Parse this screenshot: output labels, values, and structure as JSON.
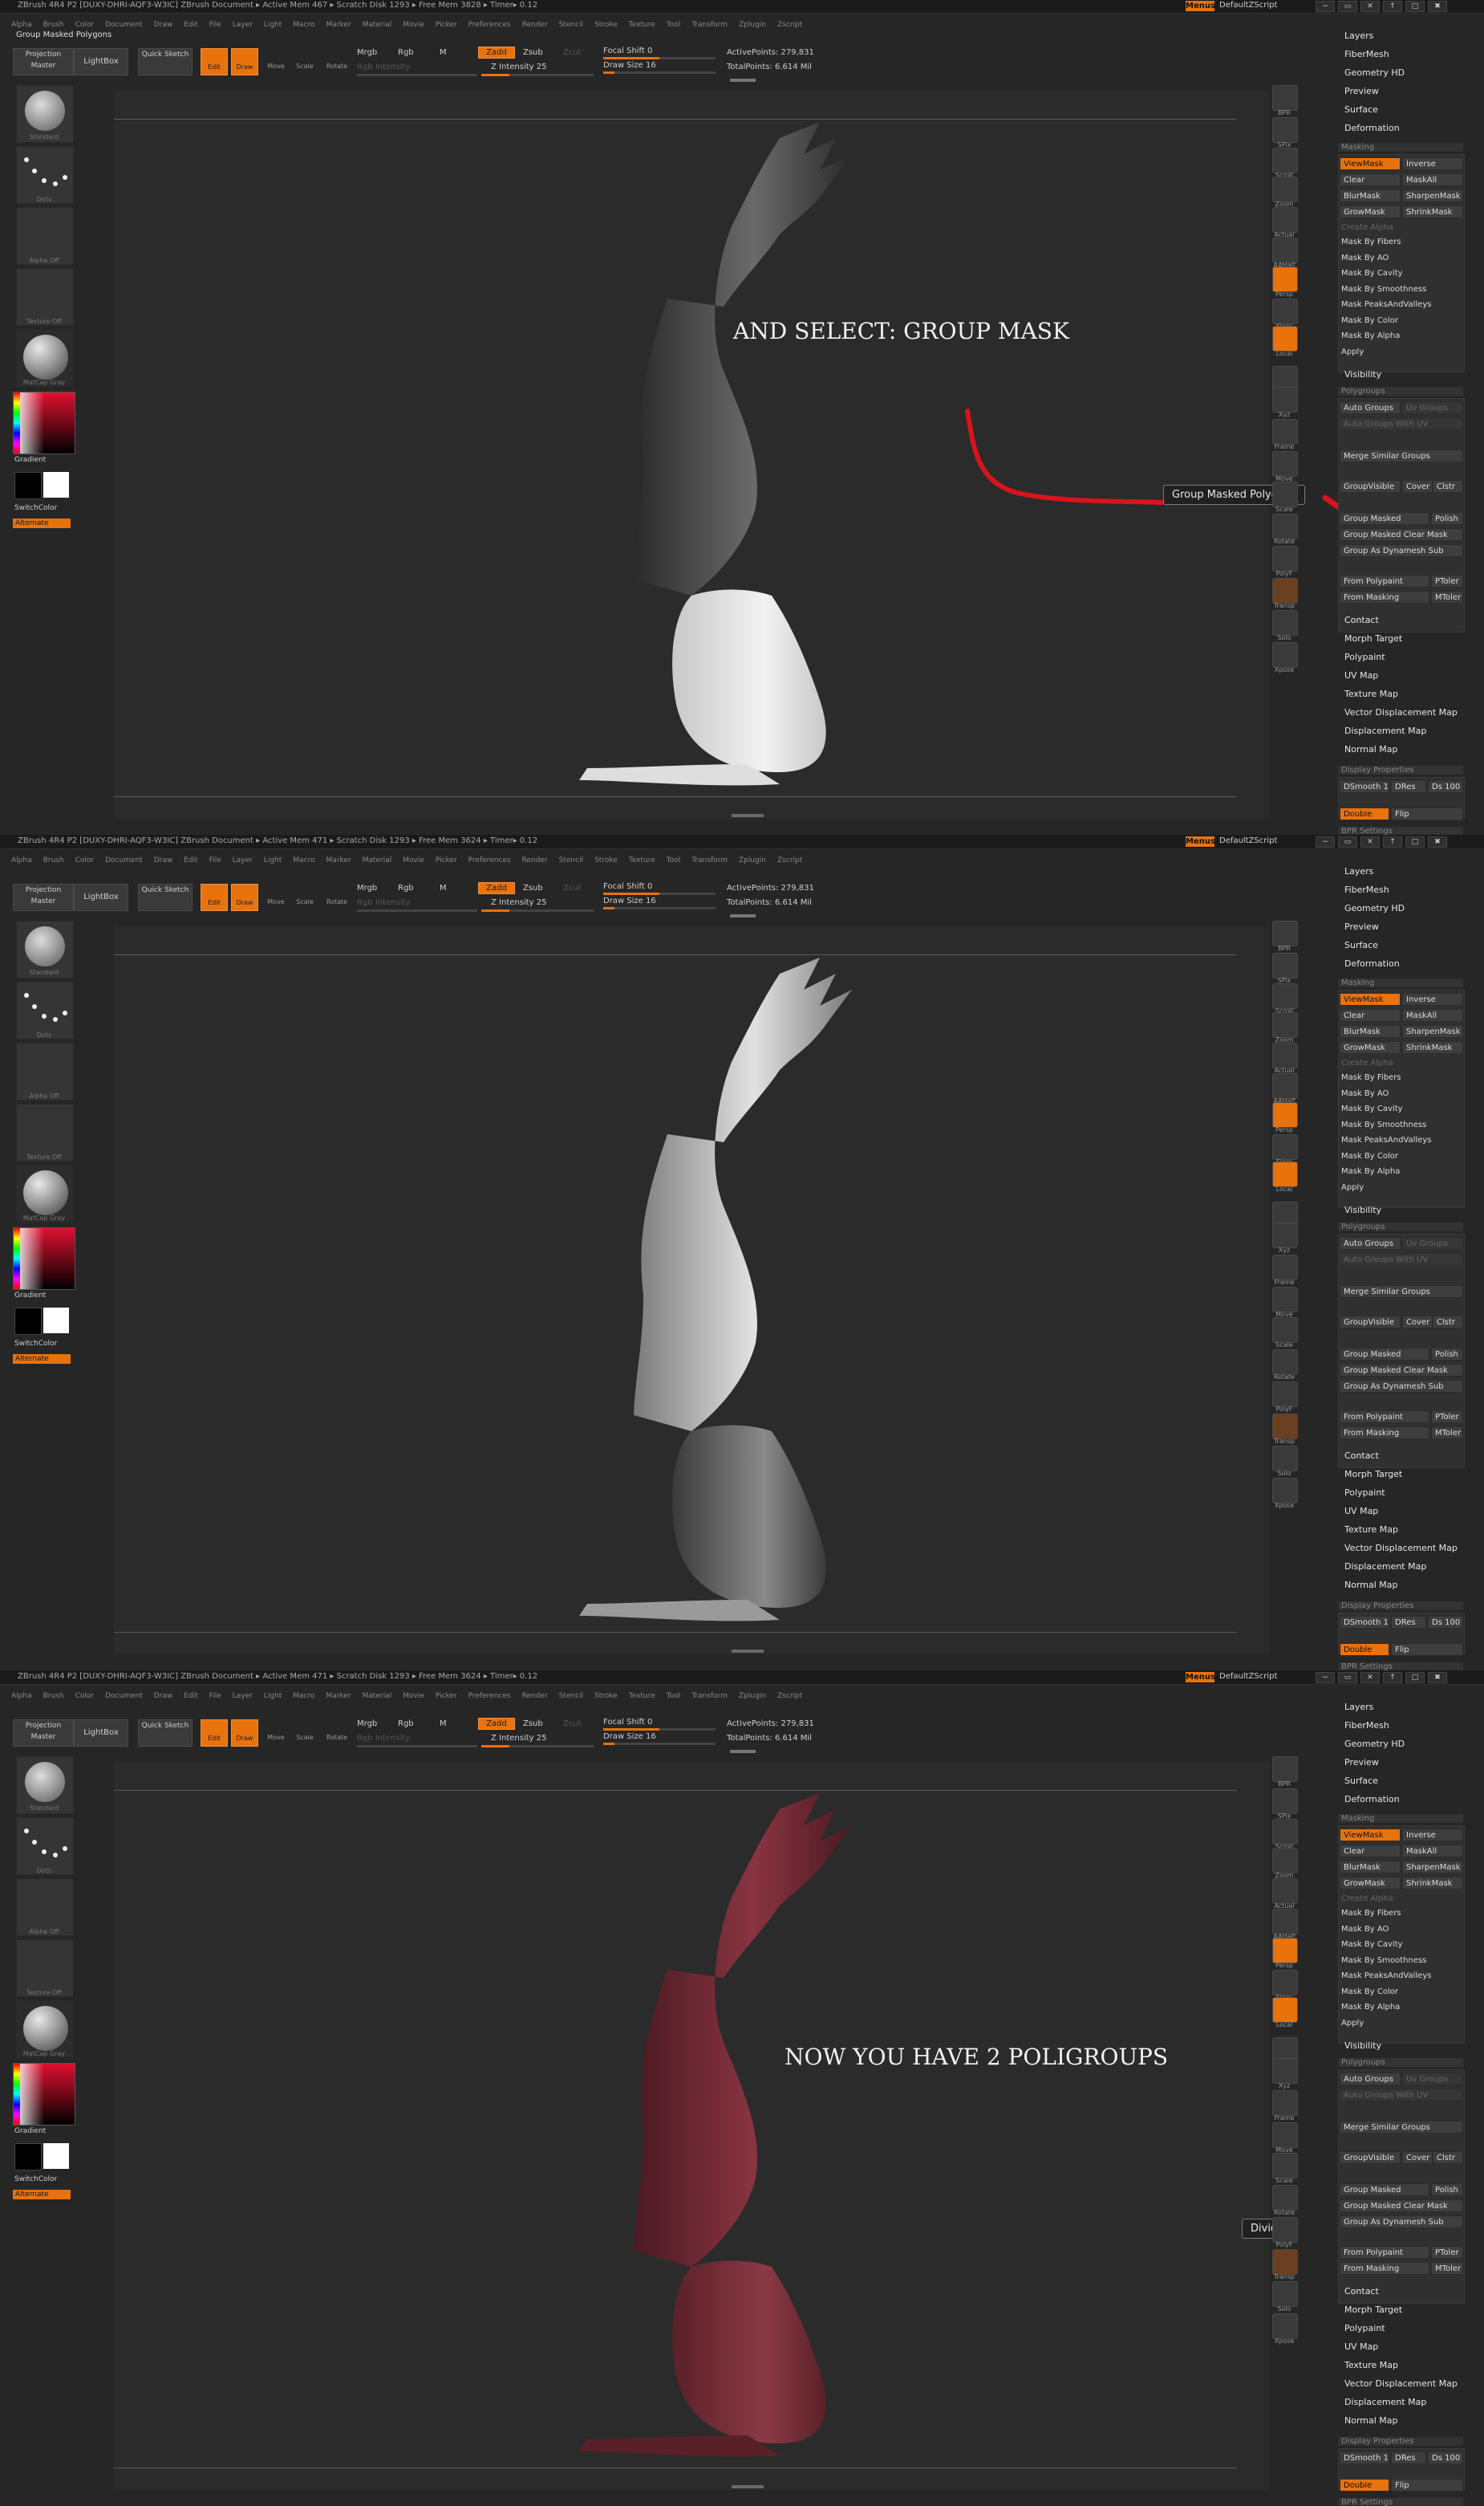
{
  "app": {
    "title_text": "ZBrush 4R4 P2 [DUXY-DHRI-AQF3-W3IC]    ZBrush Document",
    "status_text_p1": "▸ Active Mem 467 ▸ Scratch Disk 1293 ▸ Free Mem 3828 ▸ Timer▸ 0.12",
    "status_text_p2": "▸ Active Mem 471 ▸ Scratch Disk 1293 ▸ Free Mem 3624 ▸ Timer▸ 0.12",
    "status_text_p3": "▸ Active Mem 471 ▸ Scratch Disk 1293 ▸ Free Mem 3624 ▸ Timer▸ 0.12",
    "menus_label": "Menus",
    "default_script": "DefaultZScript",
    "tooltip_line_p1": "Group Masked Polygons",
    "window_buttons": [
      "−",
      "▭",
      "✕",
      "↑",
      "□",
      "✖"
    ]
  },
  "menubar": [
    "Alpha",
    "Brush",
    "Color",
    "Document",
    "Draw",
    "Edit",
    "File",
    "Layer",
    "Light",
    "Macro",
    "Marker",
    "Material",
    "Movie",
    "Picker",
    "Preferences",
    "Render",
    "Stencil",
    "Stroke",
    "Texture",
    "Tool",
    "Transform",
    "Zplugin",
    "Zscript"
  ],
  "toolbar": {
    "projection_master": "Projection Master",
    "lightbox": "LightBox",
    "quick_sketch": "Quick Sketch",
    "edit": "Edit",
    "draw": "Draw",
    "move": "Move",
    "scale": "Scale",
    "rotate": "Rotate",
    "mrgb": "Mrgb",
    "rgb": "Rgb",
    "m": "M",
    "rgb_intensity": "Rgb Intensity",
    "zadd": "Zadd",
    "zsub": "Zsub",
    "zcut": "Zcut",
    "z_intensity": "Z Intensity 25",
    "focal_shift": "Focal Shift 0",
    "draw_size": "Draw Size 16",
    "active_points": "ActivePoints: 279,831",
    "total_points": "TotalPoints: 6.614 Mil",
    "z_intensity_value": 25,
    "draw_size_value": 16
  },
  "left_shelf": {
    "standard": "Standard",
    "dots": "Dots",
    "alpha_off": "Alpha Off",
    "texture_off": "Texture Off",
    "matcap_gray": "MatCap Gray",
    "gradient": "Gradient",
    "switch_color": "SwitchColor",
    "alternate": "Alternate"
  },
  "right_icons": [
    "BPR",
    "SPix",
    "Scroll",
    "Zoom",
    "Actual",
    "AAHalf",
    "Persp",
    "Floor",
    "Local",
    "L.Sym",
    "Xyz",
    "Frame",
    "Move",
    "Scale",
    "Rotate",
    "PolyF",
    "Transp",
    "Solo",
    "Xpose"
  ],
  "right_palette": {
    "top_items": [
      "Layers",
      "FiberMesh",
      "Geometry HD",
      "Preview",
      "Surface",
      "Deformation"
    ],
    "masking_title": "Masking",
    "masking_buttons": [
      [
        "ViewMask",
        "Inverse"
      ],
      [
        "Clear",
        "MaskAll"
      ],
      [
        "BlurMask",
        "SharpenMask"
      ],
      [
        "GrowMask",
        "ShrinkMask"
      ]
    ],
    "create_alpha": "Create Alpha",
    "mask_items": [
      "Mask By Fibers",
      "Mask By AO",
      "Mask By Cavity",
      "Mask By Smoothness",
      "Mask PeaksAndValleys",
      "Mask By Color",
      "Mask By Alpha",
      "Apply"
    ],
    "visibility": "Visibility",
    "polygroups_title": "Polygroups",
    "auto_groups": "Auto Groups",
    "uv_groups": "Uv Groups",
    "auto_groups_uv": "Auto Groups With UV",
    "merge_similar": "Merge Similar Groups",
    "group_visible": "GroupVisible",
    "coverage": "Cover",
    "clstr": "Clstr",
    "group_masked": "Group Masked",
    "polish": "Polish",
    "group_masked_clear": "Group Masked Clear Mask",
    "group_as_dynamesh": "Group As Dynamesh Sub",
    "from_polypaint": "From Polypaint",
    "ptoler": "PToler",
    "from_masking": "From Masking",
    "mtoler": "MToler",
    "bottom_items": [
      "Contact",
      "Morph Target",
      "Polypaint",
      "UV Map",
      "Texture Map",
      "Vector Displacement Map",
      "Displacement Map",
      "Normal Map"
    ],
    "display_properties": "Display Properties",
    "dsmooth": "DSmooth 1",
    "dres": "DRes",
    "ds": "Ds 100",
    "double": "Double",
    "flip": "Flip",
    "bpr_settings": "BPR Settings"
  },
  "annotations": {
    "panel1_caption": "AND SELECT: GROUP MASK",
    "panel1_tooltip": "Group Masked Polygons",
    "panel3_caption": "NOW YOU HAVE 2 POLIGROUPS",
    "panel3_tooltip": "Divider"
  },
  "colors": {
    "accent": "#e8720c",
    "annotation_red": "#d8141c",
    "polygroup_red": "#7a2a34"
  }
}
